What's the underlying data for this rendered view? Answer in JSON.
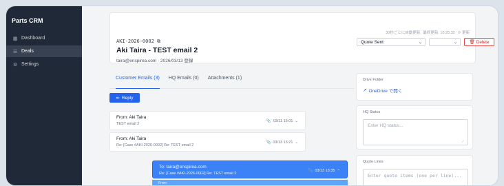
{
  "sidebar": {
    "brand": "Parts CRM",
    "items": [
      {
        "icon": "▦",
        "label": "Dashboard"
      },
      {
        "icon": "☰",
        "label": "Deals"
      },
      {
        "icon": "⚙",
        "label": "Settings"
      }
    ]
  },
  "header": {
    "refresh_note": "30秒ごとに自動更新",
    "last_updated": "最終更新: 10:25:32",
    "refresh_label": "更新",
    "case_id": "AKI-2026-0002",
    "title": "Aki Taira - TEST email 2",
    "meta": "taira@enspirea.com · 2026/03/13 登録",
    "status_value": "Quote Sent",
    "delete_label": "Delete"
  },
  "tabs": [
    {
      "label": "Customer Emails (3)"
    },
    {
      "label": "HQ Emails (0)"
    },
    {
      "label": "Attachments (1)"
    }
  ],
  "reply_label": "Reply",
  "emails": [
    {
      "from": "From: Aki Taira",
      "subject": "TEST email 2",
      "time": "03/11 16:01"
    },
    {
      "from": "From: Aki Taira",
      "subject": "Re: [Case #AKI-2026-0002] Re: TEST email 2",
      "time": "03/13 13:21"
    },
    {
      "from": "To: taira@enspirea.com",
      "subject": "Re: [Case #AKI-2026-0002] Re: TEST email 2",
      "time": "03/13 13:35"
    }
  ],
  "expanded_from": "From:",
  "drive": {
    "label": "Drive Folder",
    "link": "OneDrive で開く"
  },
  "hq_status": {
    "label": "HQ Status",
    "placeholder": "Enter HQ status..."
  },
  "quote_lines": {
    "label": "Quote Lines",
    "placeholder": "Enter quote items (one per line)..."
  }
}
